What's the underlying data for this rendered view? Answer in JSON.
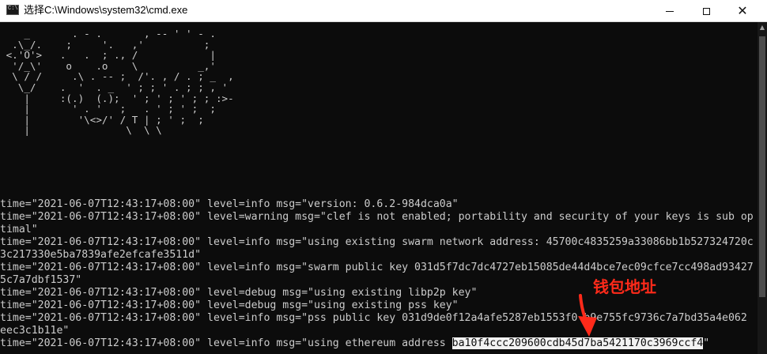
{
  "window": {
    "title": "选择C:\\Windows\\system32\\cmd.exe",
    "app_icon_text": "C:\\"
  },
  "ascii_art": "    _       . - .       , -- ' ' - .\n  .\\_/.    ;     '.   ,'          ;\n <.'O'>   .   .  ; ., /            |\n  '/_\\'    o    .o    \\          _,'\n  \\ / /     .\\ . -- ;  /'. , / . ; _  ,\n   \\_/    .  '  . _  ' ; ; ' . ; ; , '\n    |     :(.)  (.);  ' ; ' ; ' ; ; :>-\n    |       ' . '   ;   . ' ; ' ;  ;\n    |        '\\<>/' / T | ; ' ;  ;\n    |                \\  \\ \\",
  "logs": [
    "time=\"2021-06-07T12:43:17+08:00\" level=info msg=\"version: 0.6.2-984dca0a\"",
    "time=\"2021-06-07T12:43:17+08:00\" level=warning msg=\"clef is not enabled; portability and security of your keys is sub op",
    "timal\"",
    "time=\"2021-06-07T12:43:17+08:00\" level=info msg=\"using existing swarm network address: 45700c4835259a33086bb1b527324720c",
    "3c217330e5ba7839afe2efcafe3511d\"",
    "time=\"2021-06-07T12:43:17+08:00\" level=info msg=\"swarm public key 031d5f7dc7dc4727eb15085de44d4bce7ec09cfce7cc498ad93427",
    "5c7a7dbf1537\"",
    "time=\"2021-06-07T12:43:17+08:00\" level=debug msg=\"using existing libp2p key\"",
    "time=\"2021-06-07T12:43:17+08:00\" level=debug msg=\"using existing pss key\"",
    "time=\"2021-06-07T12:43:17+08:00\" level=info msg=\"pss public key 031d9de0f12a4afe5287eb1553f0 b9e755fc9736c7a7bd35a4e062",
    "eec3c1b11e\""
  ],
  "last_line": {
    "prefix": "time=\"2021-06-07T12:43:17+08:00\" level=info msg=\"using ethereum address ",
    "address": "ba10f4ccc209600cdb45d7ba5421170c3969ccf4",
    "suffix": "\""
  },
  "annotation": {
    "label": "钱包地址",
    "color": "#ff2a1a"
  },
  "colors": {
    "console_bg": "#0c0c0c",
    "console_text": "#cccccc",
    "highlight_bg": "#f2f2f2"
  }
}
